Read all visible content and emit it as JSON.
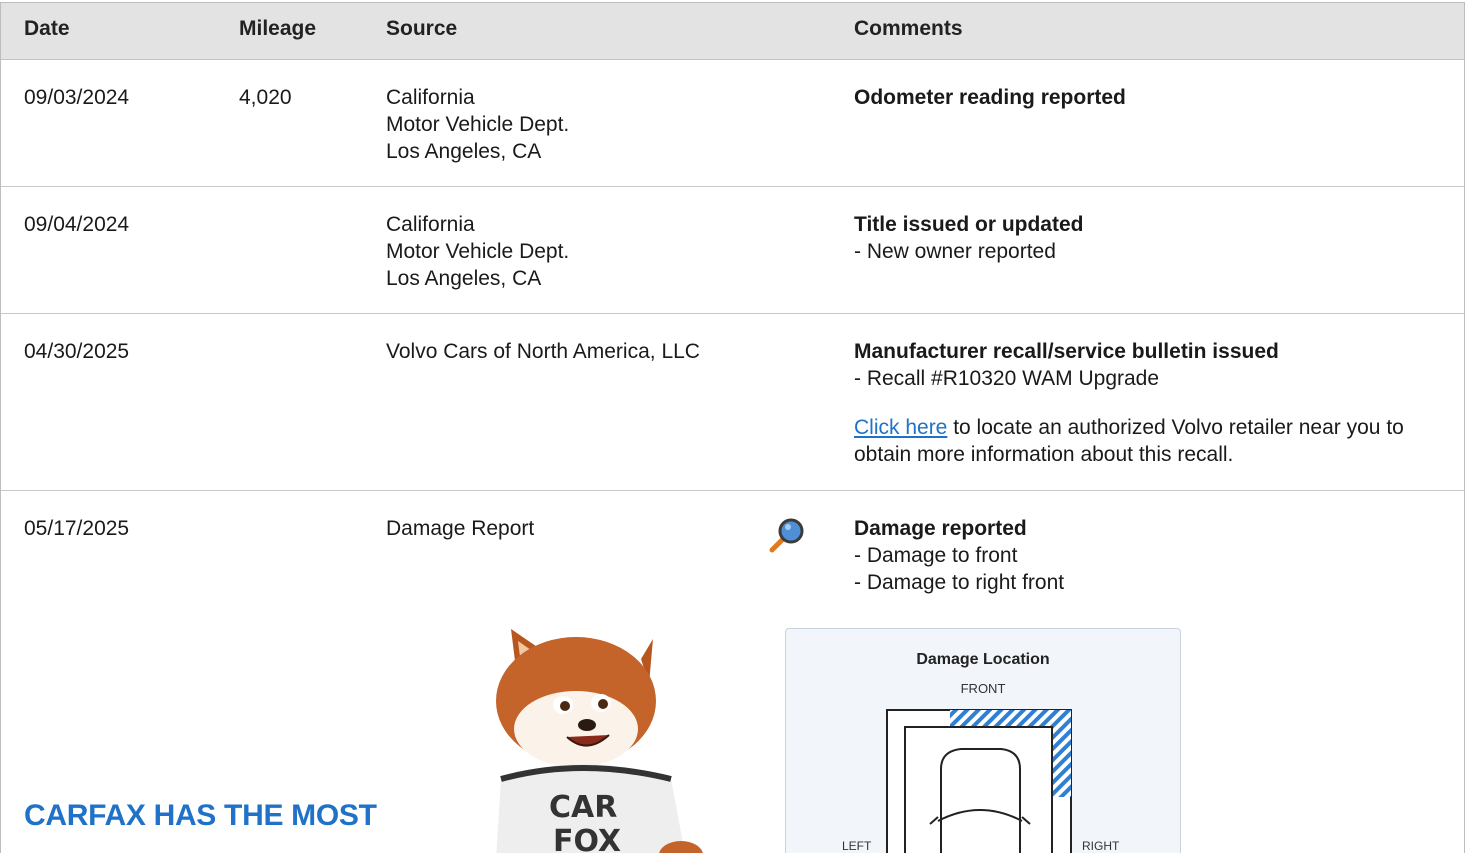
{
  "table": {
    "headers": {
      "date": "Date",
      "mileage": "Mileage",
      "source": "Source",
      "comments": "Comments"
    },
    "rows": [
      {
        "date": "09/03/2024",
        "mileage": "4,020",
        "source": [
          "California",
          "Motor Vehicle Dept.",
          "Los Angeles, CA"
        ],
        "comment_title": "Odometer reading reported"
      },
      {
        "date": "09/04/2024",
        "mileage": "",
        "source": [
          "California",
          "Motor Vehicle Dept.",
          "Los Angeles, CA"
        ],
        "comment_title": "Title issued or updated",
        "details": [
          "- New owner reported"
        ]
      },
      {
        "date": "04/30/2025",
        "mileage": "",
        "source": [
          "Volvo Cars of North America, LLC"
        ],
        "comment_title": "Manufacturer recall/service bulletin issued",
        "details": [
          "- Recall #R10320 WAM Upgrade"
        ],
        "link_text": "Click here",
        "link_suffix": " to locate an authorized Volvo retailer near you to obtain more information about this recall."
      },
      {
        "date": "05/17/2025",
        "mileage": "",
        "source": [
          "Damage Report"
        ],
        "comment_title": "Damage reported",
        "details": [
          "- Damage to front",
          "- Damage to right front"
        ]
      }
    ]
  },
  "icons": {
    "magnifier": "magnifier-icon",
    "mascot": "carfox-mascot"
  },
  "damage_panel": {
    "title": "Damage Location",
    "front_label": "FRONT",
    "left_label": "LEFT",
    "right_label": "RIGHT"
  },
  "mascot_shirt": "CAR FOX",
  "promo": {
    "headline": "CARFAX HAS THE MOST"
  },
  "colors": {
    "accent": "#1f72c7",
    "header_bg": "#e3e3e3",
    "damage_hatch": "#2f7fd4"
  }
}
